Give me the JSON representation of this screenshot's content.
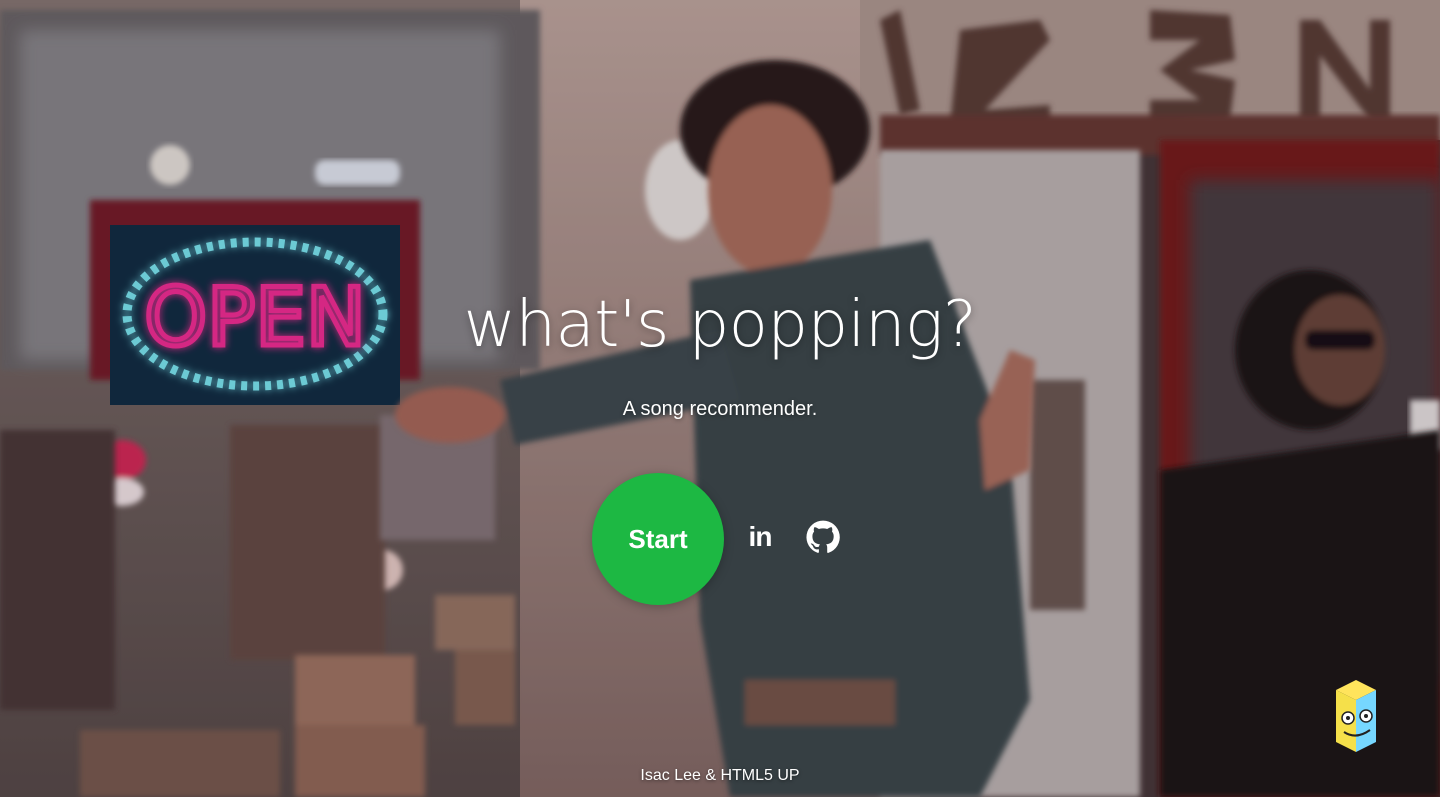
{
  "hero": {
    "title": "what's popping?",
    "subtitle": "A song recommender.",
    "start_label": "Start"
  },
  "social": {
    "linkedin_label": "in",
    "linkedin_icon": "linkedin-icon",
    "github_icon": "github-icon"
  },
  "footer": {
    "credit": "Isac Lee & HTML5 UP"
  },
  "background": {
    "neon_sign_text": "OPEN",
    "building_number": "123 N"
  },
  "colors": {
    "accent": "#1db843",
    "neon_pink": "#ff2f9d",
    "neon_cyan": "#7ff4ff",
    "text": "#ffffff"
  }
}
